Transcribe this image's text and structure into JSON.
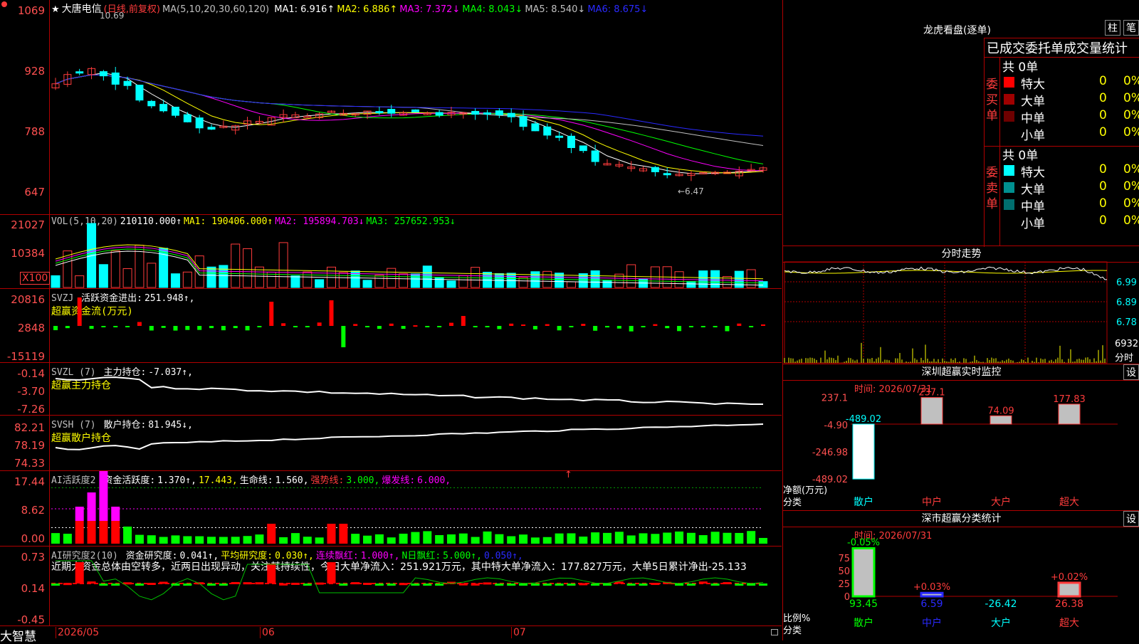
{
  "colors": {
    "up": "#ff3c3c",
    "down": "#00ffff",
    "ma1": "#ffffff",
    "ma2": "#ffff00",
    "ma3": "#ff00ff",
    "ma4": "#00ff00",
    "ma5": "#c0c0c0",
    "ma6": "#2a2aff",
    "frame": "#b00000"
  },
  "kline": {
    "title_star": "★",
    "stock_name": "大唐电信",
    "mode": "(日线,前复权)",
    "ma_label": "MA(5,10,20,30,60,120)",
    "ma": [
      {
        "k": "MA1:",
        "v": "6.916↑",
        "c": "wht"
      },
      {
        "k": "MA2:",
        "v": "6.886↑",
        "c": "yel"
      },
      {
        "k": "MA3:",
        "v": "7.372↓",
        "c": "mag"
      },
      {
        "k": "MA4:",
        "v": "8.043↓",
        "c": "grn"
      },
      {
        "k": "MA5:",
        "v": "8.540↓",
        "c": "gry"
      },
      {
        "k": "MA6:",
        "v": "8.675↓",
        "c": "blu"
      }
    ],
    "y_labels": [
      "1069",
      "928",
      "788",
      "647"
    ],
    "high_mark": "10.69",
    "low_mark": "←6.47"
  },
  "vol": {
    "label": "VOL(5,10,20)",
    "value": "210110.000↑",
    "ma1": "MA1: 190406.000↑",
    "ma2": "MA2: 195894.703↓",
    "ma3": "MA3: 257652.953↓",
    "y_labels": [
      "21027",
      "10384"
    ],
    "unit": "X100"
  },
  "svzj": {
    "label": "SVZJ",
    "name": "活跃资金进出:",
    "value": "251.948↑,",
    "sub": "超赢资金流(万元)",
    "y_labels": [
      "20816",
      "2848",
      "-15119"
    ]
  },
  "svzl": {
    "label": "SVZL (7)",
    "name": "主力持仓:",
    "value": "-7.037↑,",
    "sub": "超赢主力持仓",
    "y_labels": [
      "-0.14",
      "-3.70",
      "-7.26"
    ]
  },
  "svsh": {
    "label": "SVSH (7)",
    "name": "散户持仓:",
    "value": "81.945↓,",
    "sub": "超赢散户持仓",
    "y_labels": [
      "82.21",
      "78.19",
      "74.33"
    ]
  },
  "ai1": {
    "label": "AI活跃度2",
    "a": "资金活跃度:",
    "av": "1.370↑,",
    "b": "17.443,",
    "c": "生命线:",
    "cv": "1.560,",
    "d": "强势线:",
    "dv": "3.000,",
    "e": "爆发线:",
    "ev": "6.000,",
    "arrow": "↑",
    "y_labels": [
      "17.44",
      "8.62",
      "0.00"
    ]
  },
  "ai2": {
    "label": "AI研究度2(10)",
    "a": "资金研究度:",
    "av": "0.041↑,",
    "b": "平均研究度:",
    "bv": "0.030↑,",
    "c": "连续飘红:",
    "cv": "1.000↑,",
    "d": "N日飘红:",
    "dv": "5.000↑,",
    "e": "0.050↑,",
    "sentence": "近期大资金总体由空转多，近两日出现异动，关注其持续性，今日大单净流入：251.921万元，其中特大单净流入：177.827万元，大单5日累计净出-25.133",
    "y_labels": [
      "0.73",
      "0.14",
      "-0.45"
    ]
  },
  "footer": {
    "brand": "大智慧",
    "dates": [
      "2026/05",
      "06",
      "07"
    ]
  },
  "lhb": {
    "title": "龙虎看盘(逐单)",
    "btn1": "柱",
    "btn2": "笔",
    "header": "已成交委托单成交量统计",
    "buy": {
      "side": "委买单",
      "total": "共 0单",
      "rows": [
        {
          "n": "特大",
          "v": "0",
          "p": "0%",
          "c": "#ff0000"
        },
        {
          "n": "大单",
          "v": "0",
          "p": "0%",
          "c": "#a00000"
        },
        {
          "n": "中单",
          "v": "0",
          "p": "0%",
          "c": "#6e0000"
        },
        {
          "n": "小单",
          "v": "0",
          "p": "0%",
          "c": ""
        }
      ]
    },
    "sell": {
      "side": "委卖单",
      "total": "共 0单",
      "rows": [
        {
          "n": "特大",
          "v": "0",
          "p": "0%",
          "c": "#00ffff"
        },
        {
          "n": "大单",
          "v": "0",
          "p": "0%",
          "c": "#009090"
        },
        {
          "n": "中单",
          "v": "0",
          "p": "0%",
          "c": "#006e6e"
        },
        {
          "n": "小单",
          "v": "0",
          "p": "0%",
          "c": ""
        }
      ]
    }
  },
  "fenshi": {
    "title": "分时走势",
    "labels": [
      "6.99",
      "6.89",
      "6.78"
    ],
    "vol": "6932",
    "vol_unit": "分时"
  },
  "sz_monitor": {
    "title": "深圳超赢实时监控",
    "btn": "设",
    "time": "时间: 2026/07/31",
    "y_labels": [
      "237.1",
      "-4.90",
      "-246.98",
      "-489.02"
    ],
    "bars": [
      {
        "cat": "散户",
        "val": -489.02,
        "label": "-489.02"
      },
      {
        "cat": "中户",
        "val": 237.1,
        "label": "237.1"
      },
      {
        "cat": "大户",
        "val": 74.09,
        "label": "74.09"
      },
      {
        "cat": "超大",
        "val": 177.83,
        "label": "177.83"
      }
    ],
    "axis_title": "净额(万元)",
    "axis_sub": "分类"
  },
  "sz_class": {
    "title": "深市超赢分类统计",
    "btn": "设",
    "time": "时间: 2026/07/31",
    "y_labels": [
      "75",
      "50",
      "25",
      "0"
    ],
    "bars": [
      {
        "cat": "散户",
        "val": 93.45,
        "label": "93.45",
        "chg": "-0.05%"
      },
      {
        "cat": "中户",
        "val": 6.59,
        "label": "6.59",
        "chg": "+0.03%"
      },
      {
        "cat": "大户",
        "val": -26.42,
        "label": "-26.42",
        "chg": ""
      },
      {
        "cat": "超大",
        "val": 26.38,
        "label": "26.38",
        "chg": "+0.02%"
      }
    ],
    "axis_title": "比例%",
    "axis_sub": "分类"
  }
}
